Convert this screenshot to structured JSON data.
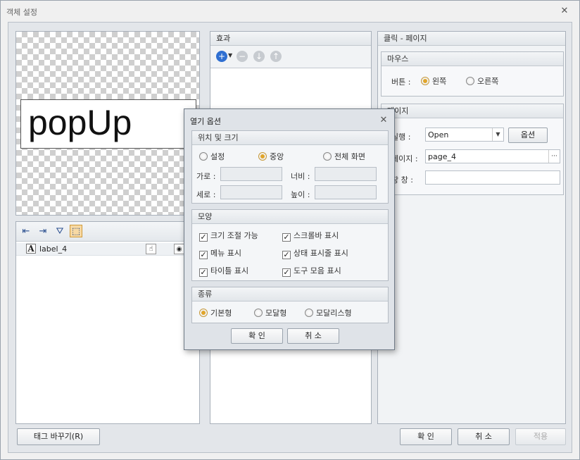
{
  "window": {
    "title": "객체 설정"
  },
  "preview": {
    "text": "popUp"
  },
  "layers": {
    "item_label": "label_4",
    "item_type_glyph": "A"
  },
  "effects": {
    "header": "효과"
  },
  "action": {
    "header": "클릭 - 페이지",
    "mouse": {
      "header": "마우스",
      "button_label": "버튼 :",
      "left": "왼쪽",
      "right": "오른쪽",
      "selected": "left"
    },
    "page": {
      "header": "페이지",
      "run_label": "실행 :",
      "run_value": "Open",
      "options_button": "옵션",
      "page_label": "페이지 :",
      "page_value": "page_4",
      "browse_button": "···",
      "window_label": "창 창 :",
      "window_value": ""
    }
  },
  "dialog": {
    "title": "열기 옵션",
    "position": {
      "header": "위치 및 크기",
      "opt_custom": "설정",
      "opt_center": "중앙",
      "opt_full": "전체 화면",
      "selected": "center",
      "x_label": "가로 :",
      "width_label": "너비 :",
      "y_label": "세로 :",
      "height_label": "높이 :",
      "x_value": "",
      "width_value": "",
      "y_value": "",
      "height_value": ""
    },
    "shape": {
      "header": "모양",
      "resizable": "크기 조절 가능",
      "scrollbar": "스크롤바 표시",
      "menu": "메뉴 표시",
      "statusbar": "상태 표시줄 표시",
      "titlebar": "타이틀 표시",
      "toolbar": "도구 모음 표시"
    },
    "kind": {
      "header": "종류",
      "basic": "기본형",
      "modal": "모달형",
      "modeless": "모달리스형",
      "selected": "basic"
    },
    "ok": "확 인",
    "cancel": "취 소"
  },
  "footer": {
    "change_tag": "태그 바꾸기(R)",
    "ok": "확 인",
    "cancel": "취 소",
    "apply": "적용"
  }
}
